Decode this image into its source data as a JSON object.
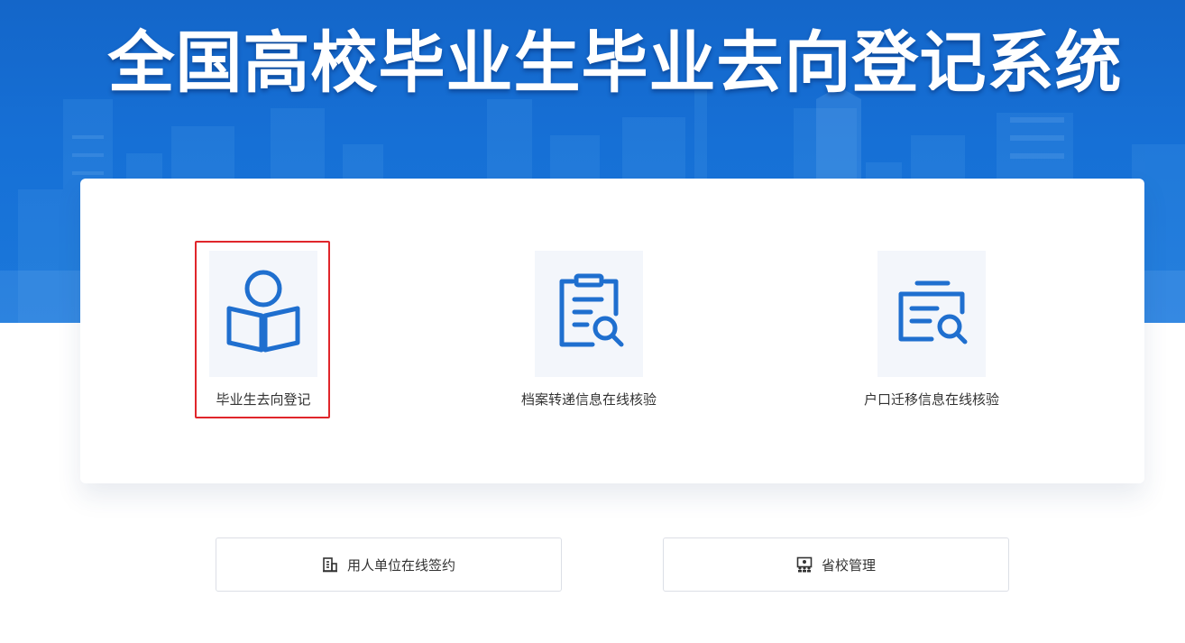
{
  "banner": {
    "title": "全国高校毕业生毕业去向登记系统"
  },
  "modules": [
    {
      "label": "毕业生去向登记",
      "icon": "reader-book-icon"
    },
    {
      "label": "档案转递信息在线核验",
      "icon": "document-search-icon"
    },
    {
      "label": "户口迁移信息在线核验",
      "icon": "record-search-icon"
    }
  ],
  "bottom_links": [
    {
      "label": "用人单位在线签约",
      "icon": "building-icon"
    },
    {
      "label": "省校管理",
      "icon": "classroom-icon"
    }
  ],
  "colors": {
    "banner": "#1670d6",
    "icon_blue": "#1f6fcf",
    "highlight": "#e0262b",
    "icon_bg": "#f3f6fb"
  }
}
